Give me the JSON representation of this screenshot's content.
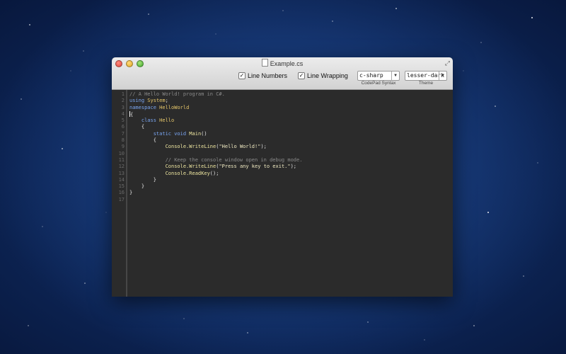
{
  "window": {
    "title": "Example.cs"
  },
  "toolbar": {
    "line_numbers_label": "Line Numbers",
    "line_wrapping_label": "Line Wrapping",
    "syntax_value": "c-sharp",
    "syntax_label": "CodePad Syntax",
    "theme_value": "lesser-dark",
    "theme_label": "Theme"
  },
  "editor": {
    "line_numbers": [
      "1",
      "2",
      "3",
      "4",
      "5",
      "6",
      "7",
      "8",
      "9",
      "10",
      "11",
      "12",
      "13",
      "14",
      "15",
      "16",
      "17"
    ],
    "lines": [
      [
        {
          "t": "// A Hello World! program in C#.",
          "c": "comment"
        }
      ],
      [
        {
          "t": "using ",
          "c": "kw"
        },
        {
          "t": "System",
          "c": "ty"
        },
        {
          "t": ";",
          "c": ""
        }
      ],
      [
        {
          "t": "namespace ",
          "c": "kw"
        },
        {
          "t": "HelloWorld",
          "c": "ty"
        }
      ],
      [
        {
          "t": "{",
          "c": ""
        }
      ],
      [
        {
          "t": "    class ",
          "c": "kw"
        },
        {
          "t": "Hello",
          "c": "ty"
        }
      ],
      [
        {
          "t": "    {",
          "c": ""
        }
      ],
      [
        {
          "t": "        static void ",
          "c": "kw"
        },
        {
          "t": "Main",
          "c": "fn"
        },
        {
          "t": "()",
          "c": ""
        }
      ],
      [
        {
          "t": "        {",
          "c": ""
        }
      ],
      [
        {
          "t": "            Console.WriteLine",
          "c": "fn"
        },
        {
          "t": "(",
          "c": ""
        },
        {
          "t": "\"Hello World!\"",
          "c": "str"
        },
        {
          "t": ");",
          "c": ""
        }
      ],
      [],
      [
        {
          "t": "            // Keep the console window open in debug mode.",
          "c": "comment"
        }
      ],
      [
        {
          "t": "            Console.WriteLine",
          "c": "fn"
        },
        {
          "t": "(",
          "c": ""
        },
        {
          "t": "\"Press any key to exit.\"",
          "c": "str"
        },
        {
          "t": ");",
          "c": ""
        }
      ],
      [
        {
          "t": "            Console.ReadKey",
          "c": "fn"
        },
        {
          "t": "();",
          "c": ""
        }
      ],
      [
        {
          "t": "        }",
          "c": ""
        }
      ],
      [
        {
          "t": "    }",
          "c": ""
        }
      ],
      [
        {
          "t": "}",
          "c": ""
        }
      ],
      []
    ]
  }
}
